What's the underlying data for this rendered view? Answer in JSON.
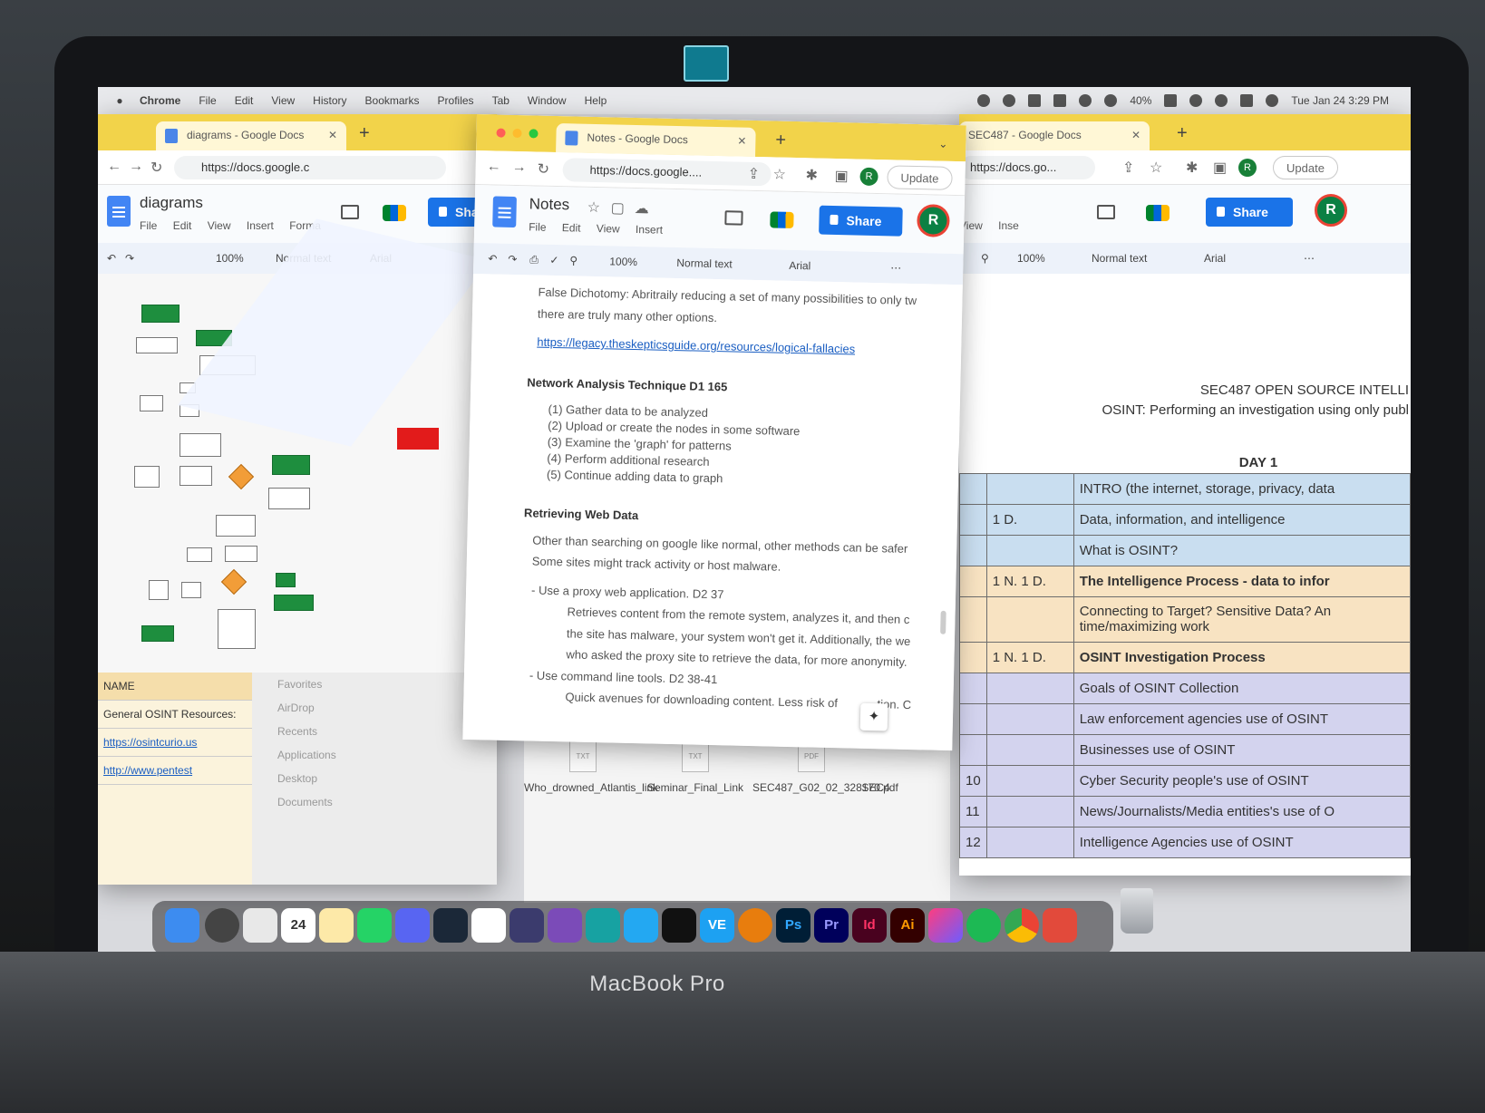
{
  "device": {
    "label": "MacBook Pro"
  },
  "menubar": {
    "app_name": "Chrome",
    "items": [
      "File",
      "Edit",
      "View",
      "History",
      "Bookmarks",
      "Profiles",
      "Tab",
      "Window",
      "Help"
    ],
    "battery": "40%",
    "clock": "Tue Jan 24  3:29 PM"
  },
  "left_window": {
    "tab_title": "diagrams - Google Docs",
    "url": "https://docs.google.c",
    "doc_title": "diagrams",
    "menu": [
      "File",
      "Edit",
      "View",
      "Insert",
      "Forma"
    ],
    "zoom": "100%",
    "style": "Normal text",
    "font": "Arial",
    "share_label": "Sha",
    "sheet_header": "NAME",
    "sheet_row1": "General OSINT Resources:",
    "sheet_link1": "https://osintcurio.us",
    "sheet_link2": "http://www.pentest-standard.org/index.php/PTES_Technical_Guidelines#Intelligence_Gathering",
    "sheet_link2_display": "http://www.pentest",
    "finder_sidebar": [
      "Favorites",
      "AirDrop",
      "Recents",
      "Applications",
      "Desktop",
      "Documents"
    ]
  },
  "middle_window": {
    "tab_title": "Notes - Google Docs",
    "url": "https://docs.google....",
    "doc_title": "Notes",
    "menu": [
      "File",
      "Edit",
      "View",
      "Insert"
    ],
    "zoom": "100%",
    "style": "Normal text",
    "font": "Arial",
    "share_label": "Share",
    "update_label": "Update",
    "avatar": "R",
    "body": {
      "fallacy_line1": "False Dichotomy: Abritraily reducing a set of many possibilities to only tw",
      "fallacy_line2": "there are truly many other options.",
      "link": "https://legacy.theskepticsguide.org/resources/logical-fallacies",
      "heading_network": "Network Analysis Technique D1 165",
      "steps": [
        "(1) Gather data to be analyzed",
        "(2) Upload or create the nodes in some software",
        "(3) Examine the 'graph' for patterns",
        "(4) Perform additional research",
        "(5) Continue adding data to graph"
      ],
      "heading_retrieving": "Retrieving Web Data",
      "retrieving_line1": "Other than searching on google like normal, other methods can be safer",
      "retrieving_line2": "Some sites might track activity or host malware.",
      "proxy_bullet": "- Use a proxy web application. D2 37",
      "proxy_line1": "Retrieves content from the remote system, analyzes it, and then c",
      "proxy_line2": "the site has malware, your system won't get it. Additionally, the we",
      "proxy_line3": "who asked the proxy site to retrieve the data, for more anonymity.",
      "cli_bullet": "- Use command line tools. D2 38-41",
      "cli_line1": "Quick avenues for downloading content. Less risk of",
      "cli_line1_end": "tion. C"
    }
  },
  "right_window": {
    "tab_title": "SEC487 - Google Docs",
    "url": "https://docs.go...",
    "menu": [
      "View",
      "Inse"
    ],
    "zoom": "100%",
    "style": "Normal text",
    "font": "Arial",
    "share_label": "Share",
    "update_label": "Update",
    "avatar": "R",
    "title": "SEC487 OPEN SOURCE INTELLI",
    "subtitle": "OSINT: Performing an investigation using only publ",
    "day": "DAY 1",
    "rows": [
      {
        "num": "",
        "code": "",
        "topic": "INTRO (the internet, storage, privacy, data",
        "color": "blue"
      },
      {
        "num": "",
        "code": "1 D.",
        "topic": "Data, information, and intelligence",
        "color": "blue"
      },
      {
        "num": "",
        "code": "",
        "topic": "What is OSINT?",
        "color": "blue"
      },
      {
        "num": "",
        "code": "1 N. 1 D.",
        "topic": "The Intelligence Process - data to infor",
        "color": "tan"
      },
      {
        "num": "",
        "code": "",
        "topic": "Connecting to Target? Sensitive Data? An time/maximizing work",
        "color": "tan-plain"
      },
      {
        "num": "",
        "code": "1 N. 1 D.",
        "topic": "OSINT Investigation Process",
        "color": "tan"
      },
      {
        "num": "",
        "code": "",
        "topic": "Goals of OSINT Collection",
        "color": "lav"
      },
      {
        "num": "",
        "code": "",
        "topic": "Law enforcement agencies use of OSINT",
        "color": "lav"
      },
      {
        "num": "",
        "code": "",
        "topic": "Businesses use of OSINT",
        "color": "lav"
      },
      {
        "num": "10",
        "code": "",
        "topic": "Cyber Security people's use of OSINT",
        "color": "lav"
      },
      {
        "num": "11",
        "code": "",
        "topic": "News/Journalists/Media entities's use of O",
        "color": "lav"
      },
      {
        "num": "12",
        "code": "",
        "topic": "Intelligence Agencies use of OSINT",
        "color": "lav"
      }
    ]
  },
  "finder_files": [
    {
      "name": "Who_drowned_Atlantis_link",
      "type": "TXT"
    },
    {
      "name": "Seminar_Final_Link",
      "type": "TXT"
    },
    {
      "name": "SEC487_G02_02_328170.pdf",
      "type": "PDF"
    },
    {
      "name": "SEC4",
      "type": ""
    }
  ],
  "dock": {
    "calendar_day": "24",
    "apps": [
      "Finder",
      "Launchpad",
      "Calendar",
      "Notes",
      "WhatsApp",
      "Discord",
      "Steam",
      "Notion",
      "GitHub Desktop",
      "Arduino",
      "VS Code",
      "Terminal",
      "VE",
      "Blender",
      "Ps",
      "Pr",
      "Id",
      "Ai",
      "Creative Cloud",
      "Spotify",
      "Chrome"
    ],
    "ve_label": "VE",
    "ps_label": "Ps",
    "pr_label": "Pr",
    "id_label": "Id",
    "ai_label": "Ai"
  }
}
